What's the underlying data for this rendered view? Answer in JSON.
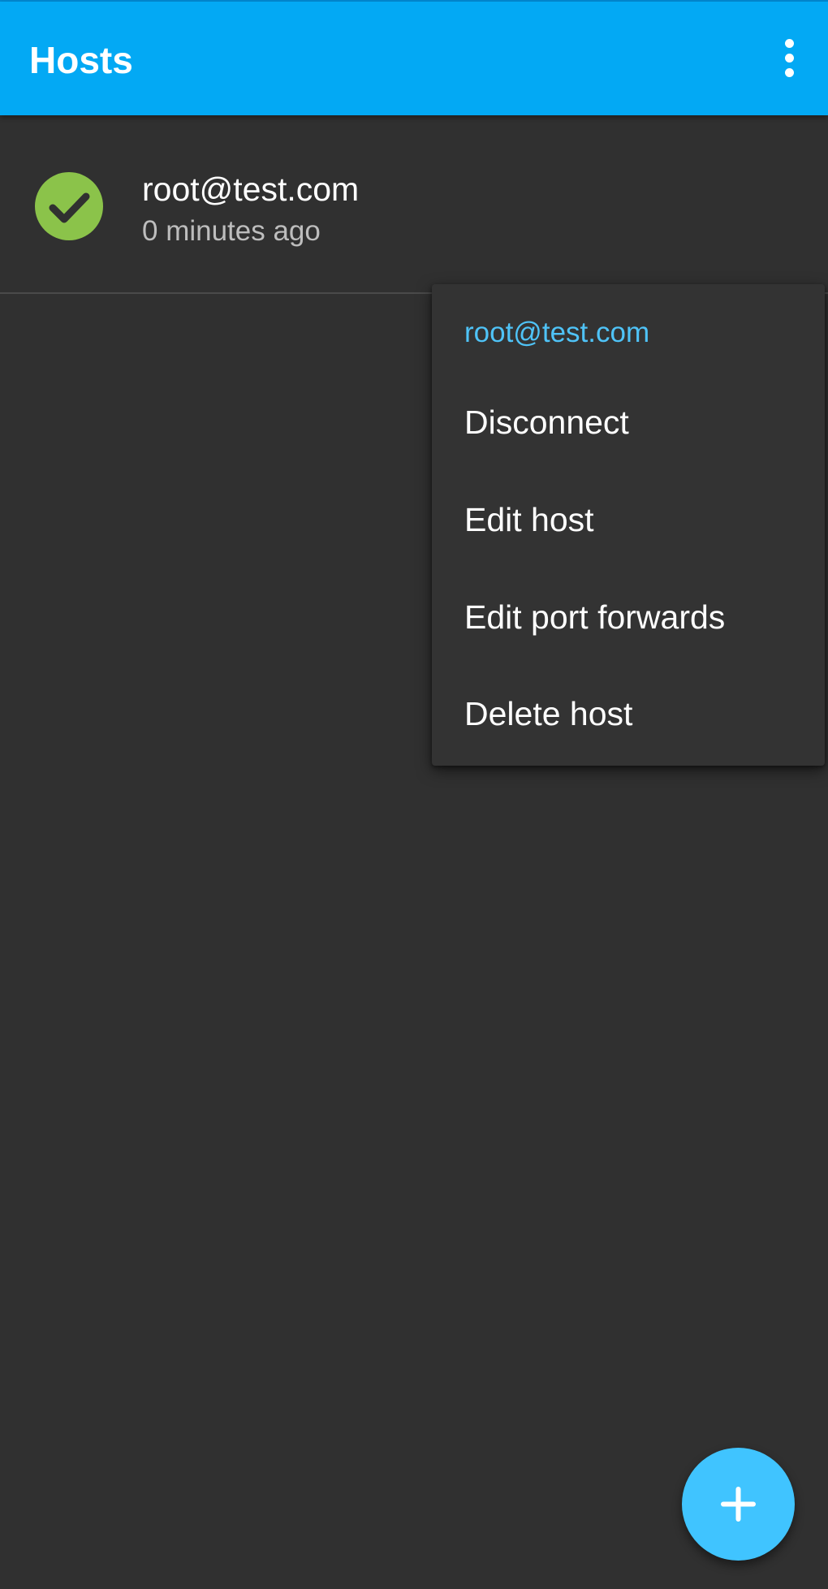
{
  "app_bar": {
    "title": "Hosts",
    "background_color": "#03a9f4",
    "overflow_icon": "more-vert-icon"
  },
  "hosts": [
    {
      "name": "root@test.com",
      "last_connected": "0 minutes ago",
      "status_icon": "check-circle-icon",
      "status_color": "#8bc34a"
    }
  ],
  "context_menu": {
    "header": "root@test.com",
    "header_color": "#4fc3f7",
    "items": [
      {
        "label": "Disconnect"
      },
      {
        "label": "Edit host"
      },
      {
        "label": "Edit port forwards"
      },
      {
        "label": "Delete host"
      }
    ]
  },
  "fab": {
    "icon": "plus-icon",
    "color": "#40c4ff"
  }
}
